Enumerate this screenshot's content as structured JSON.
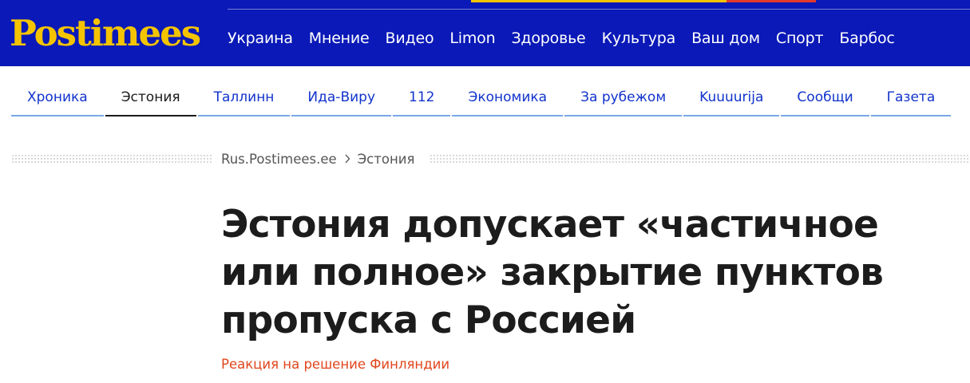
{
  "header": {
    "logo_text": "Postimees",
    "colors": {
      "bg": "#0a19b7",
      "logo_yellow": "#f5c400",
      "accent_red": "#e23a2c"
    },
    "main_nav": [
      "Украина",
      "Мнение",
      "Видео",
      "Limon",
      "Здоровье",
      "Культура",
      "Ваш дом",
      "Спорт",
      "Барбос"
    ]
  },
  "sub_nav": {
    "tabs": [
      "Хроника",
      "Эстония",
      "Таллинн",
      "Ида-Виру",
      "112",
      "Экономика",
      "За рубежом",
      "Kuuuurija",
      "Сообщи",
      "Газета"
    ],
    "active": "Эстония"
  },
  "breadcrumb": {
    "home": "Rus.Postimees.ee",
    "separator_icon": "chevron-right-icon",
    "current": "Эстония"
  },
  "article": {
    "title_lines": [
      "Эстония допускает «частичное",
      "или полное» закрытие пунктов",
      "пропуска с Россией"
    ],
    "subtitle": "Реакция на решение Финляндии",
    "subtitle_color": "#e0461c"
  }
}
